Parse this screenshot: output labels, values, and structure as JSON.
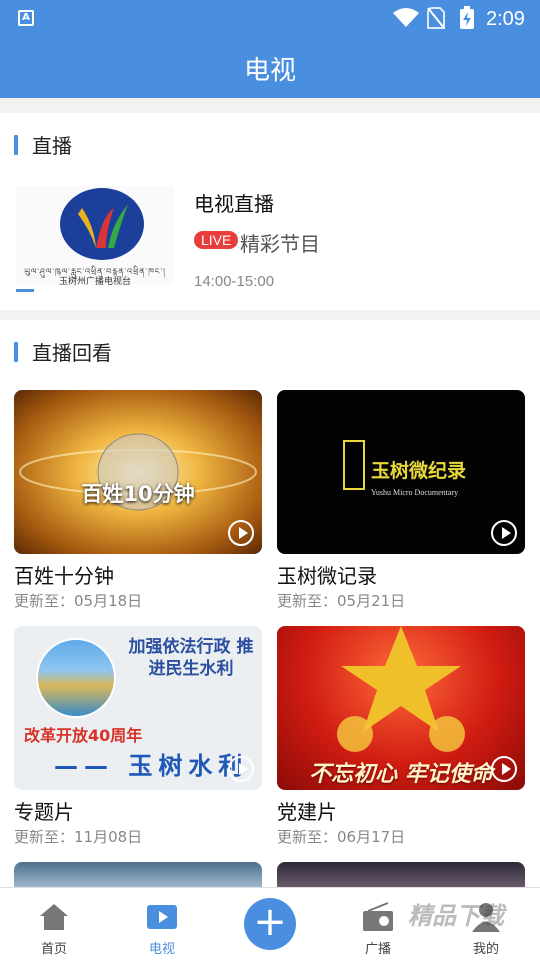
{
  "status": {
    "time": "2:09"
  },
  "header": {
    "title": "电视"
  },
  "live": {
    "section_title": "直播",
    "station_caption": "玉树州广播电视台",
    "channel_title": "电视直播",
    "badge": "LIVE",
    "program": "精彩节目",
    "time": "14:00-15:00"
  },
  "replay": {
    "section_title": "直播回看",
    "items": [
      {
        "name": "百姓十分钟",
        "updated": "更新至：05月18日",
        "thumb_text": "百姓10分钟"
      },
      {
        "name": "玉树微记录",
        "updated": "更新至：05月21日",
        "thumb_text": "玉树微纪录",
        "thumb_sub": "Yushu Micro Documentary"
      },
      {
        "name": "专题片",
        "updated": "更新至：11月08日",
        "thumb_text": "加强依法行政 推进民生水利",
        "thumb_sub": "改革开放40周年",
        "thumb_sub2": "—— 玉树水利"
      },
      {
        "name": "党建片",
        "updated": "更新至：06月17日",
        "thumb_text": "不忘初心 牢记使命"
      }
    ]
  },
  "tabbar": {
    "home": "首页",
    "tv": "电视",
    "add": "+",
    "radio": "广播",
    "mine": "我的"
  },
  "watermark": "精品下载",
  "colors": {
    "primary": "#4a8fdf",
    "live_red": "#e83d3d"
  }
}
